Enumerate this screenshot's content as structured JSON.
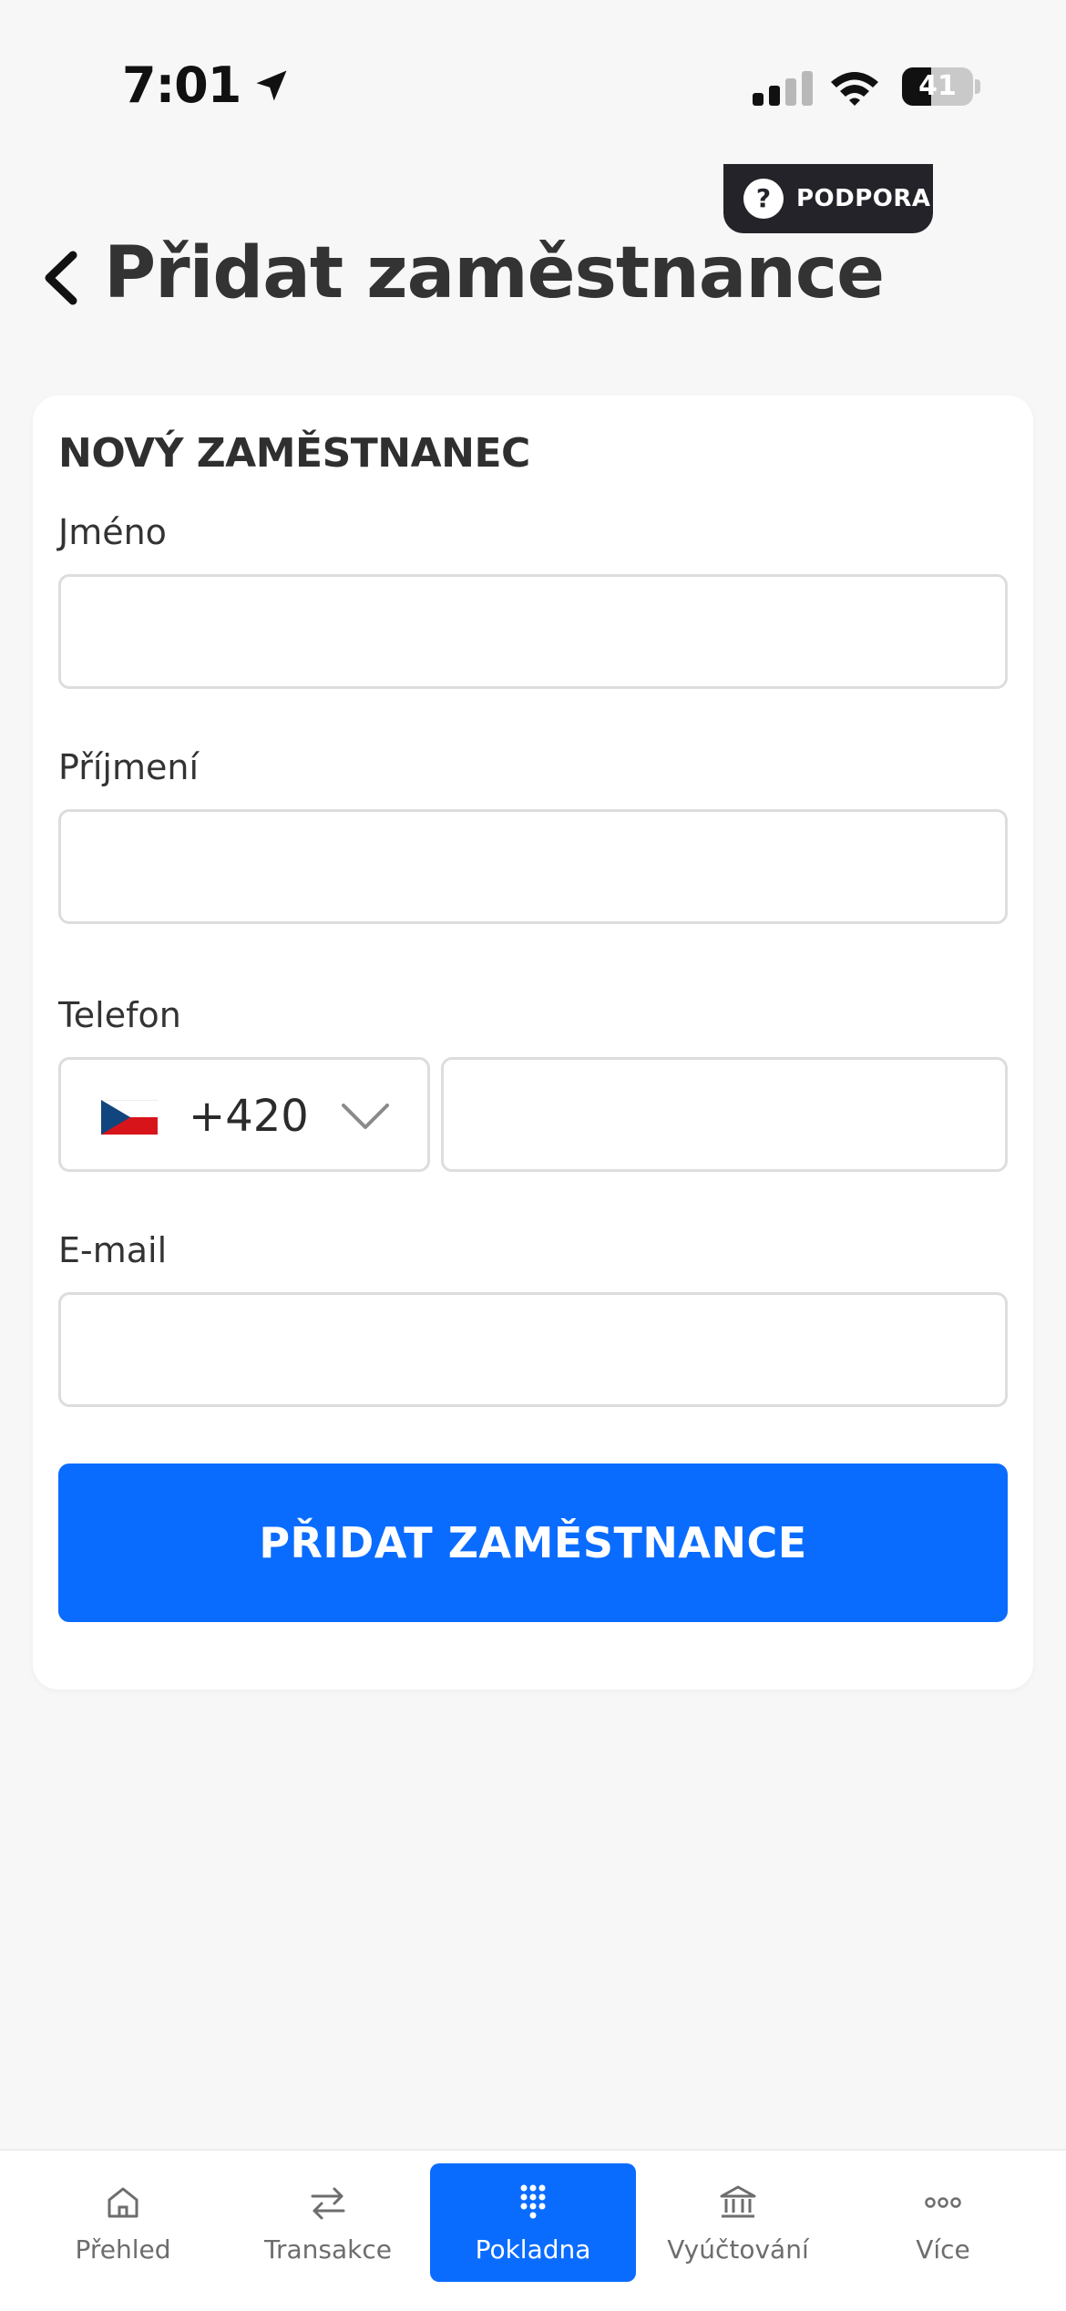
{
  "status_bar": {
    "time": "7:01",
    "battery": "41",
    "battery_level": 0.41
  },
  "support": {
    "label": "PODPORA",
    "icon": "question-icon"
  },
  "header": {
    "title": "Přidat zaměstnance",
    "back_icon": "chevron-left-icon"
  },
  "form": {
    "title": "NOVÝ ZAMĚSTNANEC",
    "first_name": {
      "label": "Jméno",
      "value": "",
      "placeholder": ""
    },
    "last_name": {
      "label": "Příjmení",
      "value": "",
      "placeholder": ""
    },
    "phone": {
      "label": "Telefon",
      "country_code": "+420",
      "country_flag": "czech-flag-icon",
      "value": "",
      "placeholder": ""
    },
    "email": {
      "label": "E-mail",
      "value": "",
      "placeholder": ""
    },
    "submit_label": "PŘIDAT ZAMĚSTNANCE"
  },
  "bottom_nav": {
    "items": [
      {
        "label": "Přehled",
        "icon": "home-icon",
        "active": false
      },
      {
        "label": "Transakce",
        "icon": "swap-arrows-icon",
        "active": false
      },
      {
        "label": "Pokladna",
        "icon": "keypad-icon",
        "active": true
      },
      {
        "label": "Vyúčtování",
        "icon": "bank-icon",
        "active": false
      },
      {
        "label": "Více",
        "icon": "more-dots-icon",
        "active": false
      }
    ]
  },
  "colors": {
    "accent": "#0a6cff",
    "background": "#f7f7f8",
    "support_bg": "#25232a",
    "border": "#dddddd"
  }
}
